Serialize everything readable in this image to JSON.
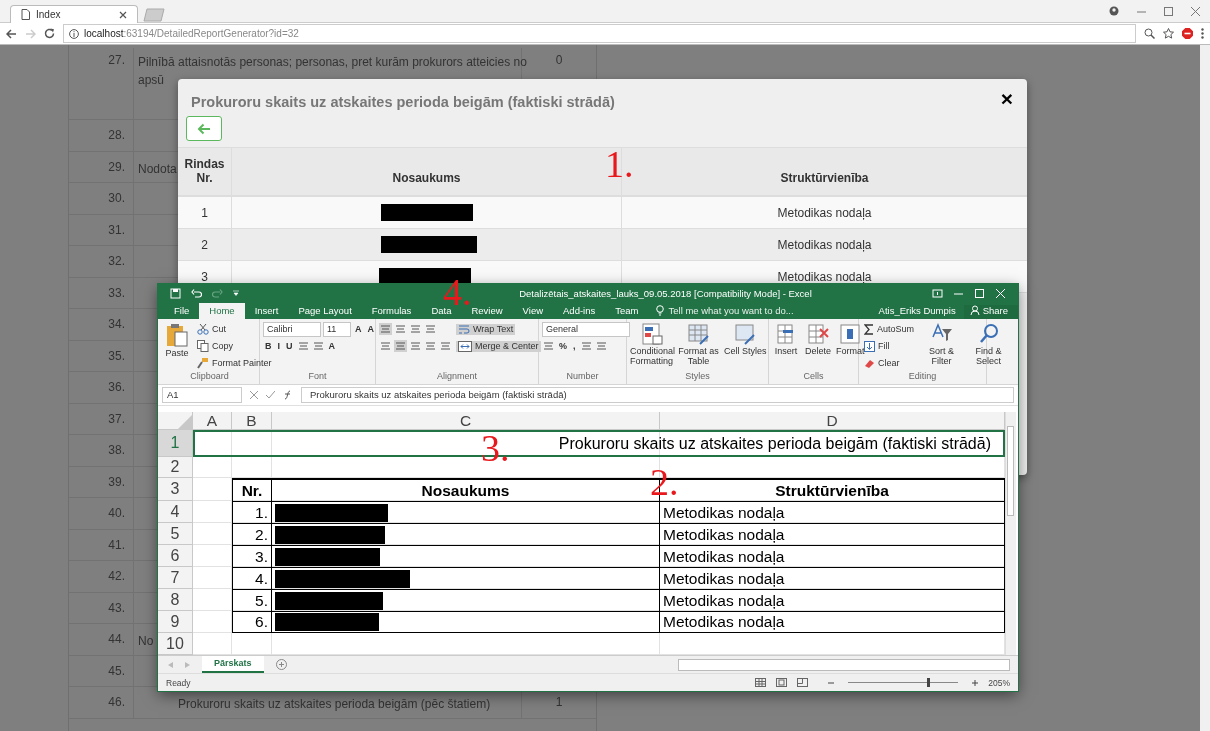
{
  "browser": {
    "tabs": [
      {
        "title": "Index",
        "selected": true
      }
    ],
    "url_host": "localhost",
    "url_rest": ":63194/DetailedReportGenerator?id=32"
  },
  "background_table": {
    "rows": [
      {
        "number": "27.",
        "lines": [
          "Pilnībā attaisnotās personas; personas, pret kurām prokurors atteicies no",
          "apsū"
        ],
        "value": "0"
      },
      {
        "number": "28."
      },
      {
        "number": "29.",
        "lines": [
          "Nodota"
        ]
      },
      {
        "number": "30."
      },
      {
        "number": "31."
      },
      {
        "number": "32."
      },
      {
        "number": "33."
      },
      {
        "number": "34."
      },
      {
        "number": "35."
      },
      {
        "number": "36."
      },
      {
        "number": "37."
      },
      {
        "number": "38."
      },
      {
        "number": "39."
      },
      {
        "number": "40."
      },
      {
        "number": "41."
      },
      {
        "number": "42."
      },
      {
        "number": "43."
      },
      {
        "number": "44.",
        "lines": [
          "No"
        ]
      },
      {
        "number": "45."
      },
      {
        "number": "46.",
        "lines": [
          "Prokuroru skaits uz atskaites perioda beigām (pēc štatiem)"
        ],
        "value": "1"
      }
    ]
  },
  "modal": {
    "title": "Prokuroru skaits uz atskaites perioda beigām (faktiski strādā)",
    "close": "×",
    "columns": [
      "Rindas Nr.",
      "Nosaukums",
      "Struktūrvienība"
    ],
    "rows": [
      {
        "number": "1",
        "name_redacted": true,
        "unit": "Metodikas nodaļa"
      },
      {
        "number": "2",
        "name_redacted": true,
        "unit": "Metodikas nodaļa"
      },
      {
        "number": "3",
        "name_redacted": true,
        "unit": "Metodikas nodaļa"
      }
    ]
  },
  "excel": {
    "title": "Detalizētais_atskaites_lauks_09.05.2018  [Compatibility Mode] - Excel",
    "ribbon_tabs": [
      {
        "label": "File",
        "selected": false
      },
      {
        "label": "Home",
        "selected": true
      },
      {
        "label": "Insert",
        "selected": false
      },
      {
        "label": "Page Layout",
        "selected": false
      },
      {
        "label": "Formulas",
        "selected": false
      },
      {
        "label": "Data",
        "selected": false
      },
      {
        "label": "Review",
        "selected": false
      },
      {
        "label": "View",
        "selected": false
      },
      {
        "label": "Add-ins",
        "selected": false
      },
      {
        "label": "Team",
        "selected": false
      }
    ],
    "tell_me": "Tell me what you want to do...",
    "user": "Atis_Eriks Dumpis",
    "share": "Share",
    "ribbon_groups": [
      {
        "label": "Clipboard",
        "items": [
          {
            "kind": "large",
            "label": "Paste"
          },
          {
            "kind": "stack",
            "lines": [
              [
                {
                  "kind": "small",
                  "label": "Cut",
                  "on": false
                }
              ],
              [
                {
                  "kind": "small",
                  "label": "Copy",
                  "on": false
                }
              ],
              [
                {
                  "kind": "small",
                  "label": "Format Painter",
                  "on": false
                }
              ]
            ]
          }
        ]
      },
      {
        "label": "Font",
        "items": [
          {
            "kind": "stack",
            "lines": [
              [
                {
                  "kind": "field",
                  "label": "Calibri"
                },
                {
                  "kind": "field",
                  "label": "11"
                },
                {
                  "kind": "glyph",
                  "label": "A"
                },
                {
                  "kind": "glyph",
                  "label": "A"
                }
              ],
              [
                {
                  "kind": "glyph",
                  "label": "B"
                },
                {
                  "kind": "glyph",
                  "label": "I"
                },
                {
                  "kind": "glyph",
                  "label": "U"
                },
                {
                  "kind": "icon"
                },
                {
                  "kind": "icon"
                },
                {
                  "kind": "glyph",
                  "label": "A"
                }
              ]
            ]
          }
        ]
      },
      {
        "label": "Alignment",
        "items": [
          {
            "kind": "stack",
            "lines": [
              [
                {
                  "kind": "icon",
                  "on": true
                },
                {
                  "kind": "icon",
                  "on": false
                },
                {
                  "kind": "icon",
                  "on": false
                },
                {
                  "kind": "icon",
                  "on": false
                }
              ],
              [
                {
                  "kind": "icon",
                  "on": false
                },
                {
                  "kind": "icon",
                  "on": true
                },
                {
                  "kind": "icon",
                  "on": false
                },
                {
                  "kind": "icon",
                  "on": false
                },
                {
                  "kind": "icon",
                  "on": false
                }
              ]
            ]
          },
          {
            "kind": "stack",
            "lines": [
              [
                {
                  "kind": "small",
                  "label": "Wrap Text",
                  "on": true
                }
              ],
              [
                {
                  "kind": "small",
                  "label": "Merge & Center",
                  "on": true
                }
              ]
            ]
          }
        ]
      },
      {
        "label": "Number",
        "items": [
          {
            "kind": "stack",
            "lines": [
              [
                {
                  "kind": "field",
                  "label": "General"
                }
              ],
              [
                {
                  "kind": "icon"
                },
                {
                  "kind": "glyph",
                  "label": "%"
                },
                {
                  "kind": "glyph",
                  "label": ","
                },
                {
                  "kind": "icon"
                },
                {
                  "kind": "icon"
                }
              ]
            ]
          }
        ]
      },
      {
        "label": "Styles",
        "items": [
          {
            "kind": "large",
            "label": "Conditional Formatting"
          },
          {
            "kind": "large",
            "label": "Format as Table"
          },
          {
            "kind": "large",
            "label": "Cell Styles"
          }
        ]
      },
      {
        "label": "Cells",
        "items": [
          {
            "kind": "large",
            "label": "Insert"
          },
          {
            "kind": "large",
            "label": "Delete"
          },
          {
            "kind": "large",
            "label": "Format"
          }
        ]
      },
      {
        "label": "Editing",
        "items": [
          {
            "kind": "stack",
            "lines": [
              [
                {
                  "kind": "small",
                  "label": "AutoSum",
                  "on": false
                }
              ],
              [
                {
                  "kind": "small",
                  "label": "Fill",
                  "on": false
                }
              ],
              [
                {
                  "kind": "small",
                  "label": "Clear",
                  "on": false
                }
              ]
            ]
          },
          {
            "kind": "large",
            "label": "Sort & Filter"
          },
          {
            "kind": "large",
            "label": "Find & Select"
          }
        ]
      }
    ],
    "name_box": "A1",
    "formula": "Prokuroru skaits uz atskaites perioda beigām (faktiski strādā)",
    "columns": [
      "A",
      "B",
      "C",
      "D"
    ],
    "row_headers": [
      {
        "label": "1",
        "selected": true
      },
      {
        "label": "2",
        "selected": false
      },
      {
        "label": "3",
        "selected": false
      },
      {
        "label": "4",
        "selected": false
      },
      {
        "label": "5",
        "selected": false
      },
      {
        "label": "6",
        "selected": false
      },
      {
        "label": "7",
        "selected": false
      },
      {
        "label": "8",
        "selected": false
      },
      {
        "label": "9",
        "selected": false
      },
      {
        "label": "10",
        "selected": false
      }
    ],
    "title_cell": "Prokuroru skaits uz atskaites perioda beigām (faktiski strādā)",
    "table_header": [
      "Nr.",
      "Nosaukums",
      "Struktūrvienība"
    ],
    "table_rows": [
      {
        "number": "1.",
        "name_redacted": true,
        "unit": "Metodikas nodaļa"
      },
      {
        "number": "2.",
        "name_redacted": true,
        "unit": "Metodikas nodaļa"
      },
      {
        "number": "3.",
        "name_redacted": true,
        "unit": "Metodikas nodaļa"
      },
      {
        "number": "4.",
        "name_redacted": true,
        "unit": "Metodikas nodaļa"
      },
      {
        "number": "5.",
        "name_redacted": true,
        "unit": "Metodikas nodaļa"
      },
      {
        "number": "6.",
        "name_redacted": true,
        "unit": "Metodikas nodaļa"
      }
    ],
    "sheet_tabs": [
      {
        "label": "Pārskats",
        "selected": true
      }
    ],
    "status": "Ready",
    "zoom_slider": {
      "level": 0.72
    },
    "zoom_text": "205%"
  },
  "annotations": [
    {
      "text": "1."
    },
    {
      "text": "4."
    },
    {
      "text": "3."
    },
    {
      "text": "2."
    }
  ]
}
